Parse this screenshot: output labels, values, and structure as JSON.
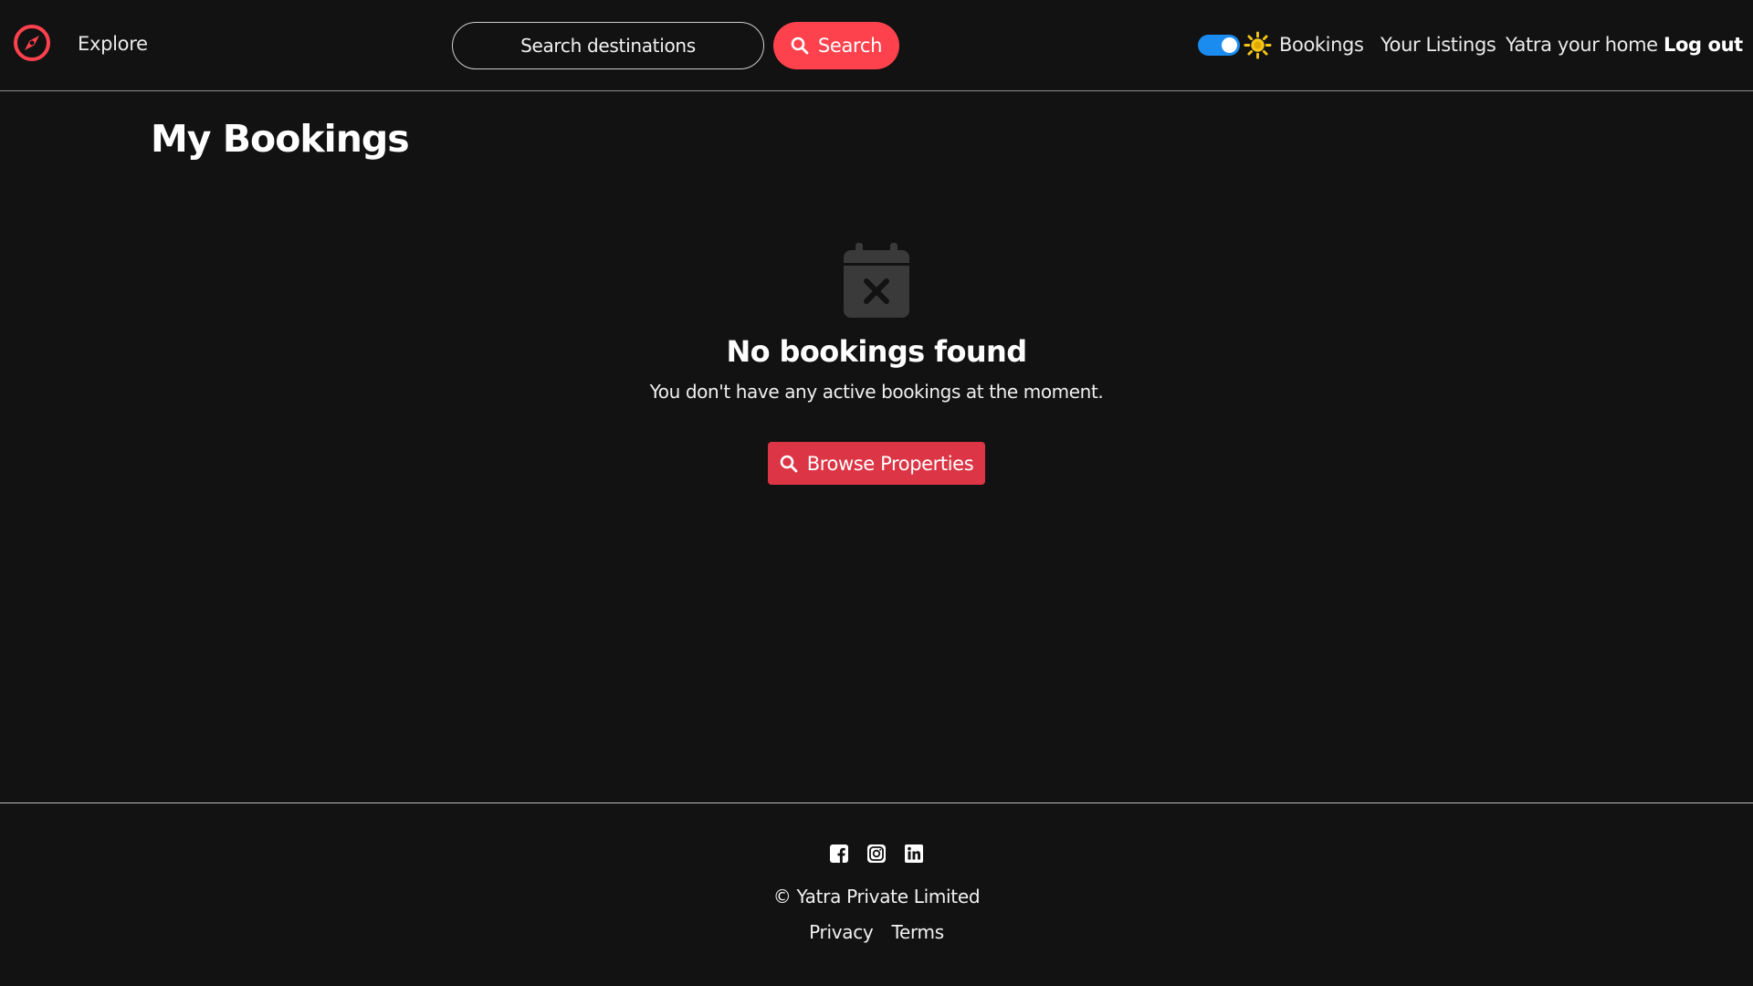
{
  "navbar": {
    "explore_label": "Explore",
    "search_placeholder": "Search destinations",
    "search_button_label": "Search",
    "theme_toggle_on": true,
    "links": {
      "bookings": "Bookings",
      "your_listings": "Your Listings",
      "yatra_your_home": "Yatra your home",
      "log_out": "Log out"
    }
  },
  "main": {
    "title": "My Bookings",
    "empty_state": {
      "icon": "calendar-x-icon",
      "heading": "No bookings found",
      "text": "You don't have any active bookings at the moment.",
      "button_label": "Browse Properties"
    }
  },
  "footer": {
    "social_icons": [
      "facebook-icon",
      "instagram-icon",
      "linkedin-icon"
    ],
    "copyright": "© Yatra Private Limited",
    "links": {
      "privacy": "Privacy",
      "terms": "Terms"
    }
  },
  "colors": {
    "background": "#121212",
    "brand": "#fe424d",
    "button_red": "#dc3545",
    "toggle_blue": "#1a8cf0",
    "sun_yellow": "#f5c518"
  }
}
